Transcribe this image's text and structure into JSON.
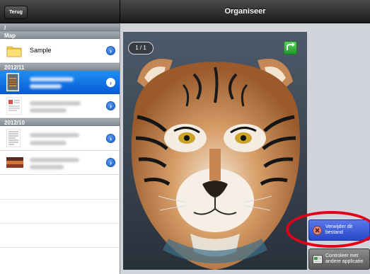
{
  "header": {
    "back_label": "Terug",
    "title": "Organiseer"
  },
  "sidebar": {
    "path": "/",
    "map_section": "Map",
    "folder": {
      "label": "Sample",
      "icon": "folder-icon"
    },
    "sections": [
      {
        "label": "2012/11"
      },
      {
        "label": "2012/10"
      }
    ]
  },
  "viewer": {
    "page_indicator": "1 / 1",
    "image_subject": "tiger"
  },
  "actions": {
    "delete_label": "Verwijder dit bestand",
    "check_label": "Controleer met andere applicatie"
  },
  "colors": {
    "selection": "#0a5cd5",
    "highlight": "#e1001a",
    "delete_button": "#2848c8"
  }
}
